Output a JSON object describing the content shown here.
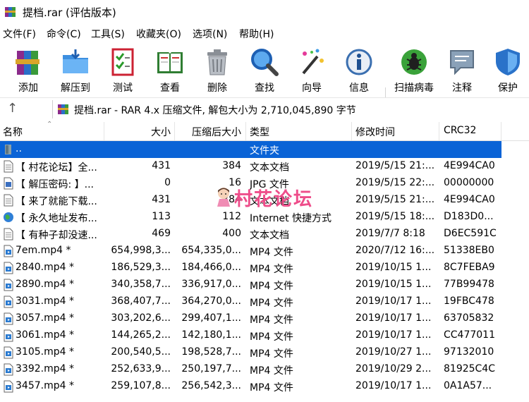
{
  "window": {
    "title": "提档.rar (评估版本)"
  },
  "menu": [
    {
      "label": "文件(F)"
    },
    {
      "label": "命令(C)"
    },
    {
      "label": "工具(S)"
    },
    {
      "label": "收藏夹(O)"
    },
    {
      "label": "选项(N)"
    },
    {
      "label": "帮助(H)"
    }
  ],
  "toolbar": [
    {
      "label": "添加",
      "icon": "add-archive-icon"
    },
    {
      "label": "解压到",
      "icon": "extract-to-icon"
    },
    {
      "label": "测试",
      "icon": "test-icon"
    },
    {
      "label": "查看",
      "icon": "view-icon"
    },
    {
      "label": "删除",
      "icon": "delete-icon"
    },
    {
      "label": "查找",
      "icon": "find-icon"
    },
    {
      "label": "向导",
      "icon": "wizard-icon"
    },
    {
      "label": "信息",
      "icon": "info-icon"
    },
    {
      "label": "扫描病毒",
      "icon": "virus-scan-icon"
    },
    {
      "label": "注释",
      "icon": "comment-icon"
    },
    {
      "label": "保护",
      "icon": "protect-icon"
    }
  ],
  "address": {
    "text": "提档.rar - RAR 4.x 压缩文件, 解包大小为 2,710,045,890 字节"
  },
  "columns": {
    "name": "名称",
    "size": "大小",
    "packed": "压缩后大小",
    "type": "类型",
    "mtime": "修改时间",
    "crc": "CRC32"
  },
  "rows": [
    {
      "name": "..",
      "size": "",
      "packed": "",
      "type": "文件夹",
      "mtime": "",
      "crc": "",
      "icon": "folder-up-icon",
      "selected": true
    },
    {
      "name": "【 村花论坛】全...",
      "size": "431",
      "packed": "384",
      "type": "文本文档",
      "mtime": "2019/5/15 21:...",
      "crc": "4E994CA0",
      "icon": "text-file-icon"
    },
    {
      "name": "【 解压密码: 】...",
      "size": "0",
      "packed": "16",
      "type": "JPG 文件",
      "mtime": "2019/5/15 22:...",
      "crc": "00000000",
      "icon": "image-file-icon"
    },
    {
      "name": "【 来了就能下载...",
      "size": "431",
      "packed": "384",
      "type": "文本文档",
      "mtime": "2019/5/15 21:...",
      "crc": "4E994CA0",
      "icon": "text-file-icon"
    },
    {
      "name": "【 永久地址发布...",
      "size": "113",
      "packed": "112",
      "type": "Internet 快捷方式",
      "mtime": "2019/5/15 18:...",
      "crc": "D183D0...",
      "icon": "globe-icon"
    },
    {
      "name": "【 有种子却没速...",
      "size": "469",
      "packed": "400",
      "type": "文本文档",
      "mtime": "2019/7/7 8:18",
      "crc": "D6EC591C",
      "icon": "text-file-icon"
    },
    {
      "name": "7em.mp4 *",
      "size": "654,998,3...",
      "packed": "654,335,0...",
      "type": "MP4 文件",
      "mtime": "2020/7/12 16:...",
      "crc": "51338EB0",
      "icon": "video-file-icon"
    },
    {
      "name": "2840.mp4 *",
      "size": "186,529,3...",
      "packed": "184,466,0...",
      "type": "MP4 文件",
      "mtime": "2019/10/15 1...",
      "crc": "8C7FEBA9",
      "icon": "video-file-icon"
    },
    {
      "name": "2890.mp4 *",
      "size": "340,358,7...",
      "packed": "336,917,0...",
      "type": "MP4 文件",
      "mtime": "2019/10/15 1...",
      "crc": "77B99478",
      "icon": "video-file-icon"
    },
    {
      "name": "3031.mp4 *",
      "size": "368,407,7...",
      "packed": "364,270,0...",
      "type": "MP4 文件",
      "mtime": "2019/10/17 1...",
      "crc": "19FBC478",
      "icon": "video-file-icon"
    },
    {
      "name": "3057.mp4 *",
      "size": "303,202,6...",
      "packed": "299,407,1...",
      "type": "MP4 文件",
      "mtime": "2019/10/17 1...",
      "crc": "63705832",
      "icon": "video-file-icon"
    },
    {
      "name": "3061.mp4 *",
      "size": "144,265,2...",
      "packed": "142,180,1...",
      "type": "MP4 文件",
      "mtime": "2019/10/17 1...",
      "crc": "CC477011",
      "icon": "video-file-icon"
    },
    {
      "name": "3105.mp4 *",
      "size": "200,540,5...",
      "packed": "198,528,7...",
      "type": "MP4 文件",
      "mtime": "2019/10/27 1...",
      "crc": "97132010",
      "icon": "video-file-icon"
    },
    {
      "name": "3392.mp4 *",
      "size": "252,633,9...",
      "packed": "250,197,7...",
      "type": "MP4 文件",
      "mtime": "2019/10/29 2...",
      "crc": "81925C4C",
      "icon": "video-file-icon"
    },
    {
      "name": "3457.mp4 *",
      "size": "259,107,8...",
      "packed": "256,542,3...",
      "type": "MP4 文件",
      "mtime": "2019/10/17 1...",
      "crc": "0A1A57...",
      "icon": "video-file-icon"
    }
  ],
  "watermark": {
    "text": "村花论坛"
  },
  "colors": {
    "selection": "#0a63d6",
    "watermark": "#ee4d8a"
  }
}
